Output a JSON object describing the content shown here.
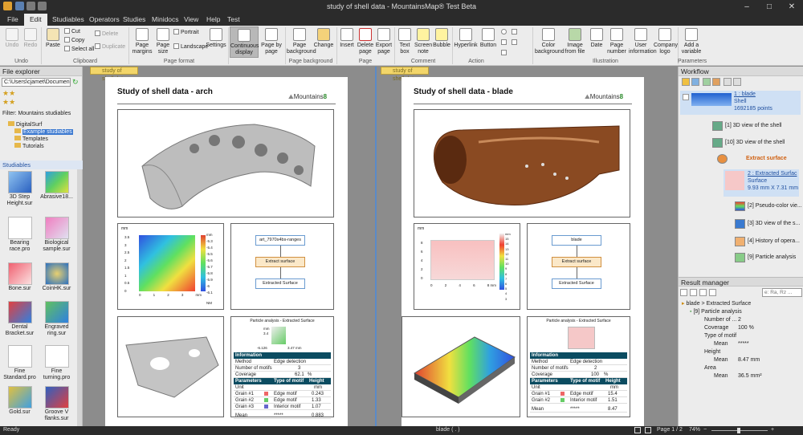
{
  "window": {
    "title": "study of shell data - MountainsMap® Test Beta",
    "minimize": "–",
    "maximize": "□",
    "close": "✕"
  },
  "menu": [
    "File",
    "Edit",
    "Studiables",
    "Operators",
    "Studies",
    "Minidocs",
    "View",
    "Help",
    "Test"
  ],
  "ribbon": {
    "undo": "Undo",
    "redo": "Redo",
    "undo_group": "Undo",
    "paste": "Paste",
    "cut": "Cut",
    "copy": "Copy",
    "select_all": "Select all",
    "delete": "Delete",
    "duplicate": "Duplicate",
    "clipboard_group": "Clipboard",
    "page_margins": "Page margins",
    "page_size": "Page size",
    "portrait": "Portrait",
    "landscape": "Landscape",
    "settings": "Settings",
    "page_format_group": "Page format",
    "continuous_display": "Continuous display",
    "page_by_page": "Page by page",
    "page_background": "Page background",
    "change": "Change",
    "page_background_group": "Page background",
    "insert": "Insert",
    "delete_page": "Delete page",
    "export_page": "Export page",
    "page_group": "Page",
    "text_box": "Text box",
    "screen_note": "Screen note",
    "bubble": "Bubble",
    "comment_group": "Comment",
    "hyperlink": "Hyperlink",
    "button": "Button",
    "action_group": "Action",
    "color_background": "Color background",
    "image_from_file": "Image from file",
    "date": "Date",
    "page_number": "Page number",
    "user_information": "User information",
    "company_logo": "Company logo",
    "illustration_group": "Illustration",
    "add_variable": "Add a variable",
    "parameters_group": "Parameters"
  },
  "file_explorer": {
    "title": "File explorer",
    "path": "C:\\Users\\cjamet\\Document",
    "filter": "Filter: Mountains studiables",
    "tree": [
      "DigitalSurf",
      "Example studiables",
      "Templates",
      "Tutorials"
    ],
    "studiables_title": "Studiables",
    "items": [
      {
        "name": "3D Step Height.sur"
      },
      {
        "name": "Abrasive18..."
      },
      {
        "name": "Bearing race.pro"
      },
      {
        "name": "Biological sample.sur"
      },
      {
        "name": "Bone.sur"
      },
      {
        "name": "CoinHK.sur"
      },
      {
        "name": "Dental Bracket.sur"
      },
      {
        "name": "Engraved ring.sur"
      },
      {
        "name": "Fine Standard.pro"
      },
      {
        "name": "Fine turning.pro"
      },
      {
        "name": "Gold.sur"
      },
      {
        "name": "Groove V flanks.sur"
      }
    ]
  },
  "docs": {
    "tab_left": "study of shell data",
    "tab_right": "study of shell data",
    "left": {
      "title": "Study of shell data - arch",
      "logo_text": "Mountains",
      "logo_num": "8",
      "map_unit": "mm",
      "map_xunit": "mm",
      "map_yticks": [
        "3.5",
        "3",
        "2.5",
        "2",
        "1.5",
        "1",
        "0.5",
        "0"
      ],
      "map_xticks": [
        "0",
        "1",
        "2",
        "3"
      ],
      "scale_ticks": [
        "mm",
        "-5.3",
        "-5.4",
        "-5.5",
        "-5.6",
        "-5.7",
        "-5.8",
        "-5.9",
        "-6",
        "-6.1"
      ],
      "scale_bottom": "NM",
      "wf_nodes": [
        "art_7970s4bs-ranges",
        "Extract surface",
        "Extracted Surface"
      ],
      "particle_title": "Particle analysis - Extracted Surface",
      "particle_scale": [
        "mm",
        "3.4",
        "-6.126",
        "3.47 mm"
      ],
      "info_header": "Information",
      "method_label": "Method",
      "method_value": "Edge detection",
      "motifs_label": "Number of motifs",
      "motifs_value": "3",
      "coverage_label": "Coverage",
      "coverage_value": "62.1",
      "coverage_unit": "%",
      "param_header": "Parameters",
      "type_header": "Type of motif",
      "height_header": "Height",
      "unit_label": "Unit",
      "unit_value": "mm",
      "grains": [
        {
          "name": "Grain #1",
          "type": "Edge motif",
          "height": "0.243"
        },
        {
          "name": "Grain #2",
          "type": "Edge motif",
          "height": "1.33"
        },
        {
          "name": "Grain #3",
          "type": "Interior motif",
          "height": "1.07"
        }
      ],
      "mean_label": "Mean",
      "mean_type": "*****",
      "mean_value": "0.883"
    },
    "right": {
      "title": "Study of shell data - blade",
      "logo_text": "Mountains",
      "logo_num": "8",
      "map_unit": "mm",
      "map_xunit": "mm",
      "map_yticks": [
        "8",
        "6",
        "4",
        "2",
        "0"
      ],
      "map_xticks": [
        "0",
        "2",
        "4",
        "6",
        "8 mm"
      ],
      "scale_ticks": [
        "mm",
        "15",
        "14",
        "13",
        "12",
        "11",
        "10",
        "9",
        "8",
        "7",
        "6",
        "5",
        "4",
        "3"
      ],
      "wf_nodes": [
        "blade",
        "Extract surface",
        "Extracted Surface"
      ],
      "particle_title": "Particle analysis - Extracted Surface",
      "info_header": "Information",
      "method_label": "Method",
      "method_value": "Edge detection",
      "motifs_label": "Number of motifs",
      "motifs_value": "2",
      "coverage_label": "Coverage",
      "coverage_value": "100",
      "coverage_unit": "%",
      "param_header": "Parameters",
      "type_header": "Type of motif",
      "height_header": "Height",
      "unit_label": "Unit",
      "unit_value": "mm",
      "grains": [
        {
          "name": "Grain #1",
          "type": "Edge motif",
          "height": "15.4"
        },
        {
          "name": "Grain #2",
          "type": "Interior motif",
          "height": "1.51"
        }
      ],
      "mean_label": "Mean",
      "mean_type": "*****",
      "mean_value": "8.47"
    }
  },
  "workflow": {
    "title": "Workflow",
    "root_title": "1 : blade",
    "root_sub": "Shell",
    "root_points": "1692185 points",
    "items": [
      "[1] 3D view of the shell",
      "[10] 3D view of the shell",
      "Extract surface",
      "2 : Extracted Surfac",
      "[2] Pseudo-color vie...",
      "[3] 3D view of the s...",
      "[4] History of opera...",
      "[9] Particle analysis"
    ],
    "extracted_sub": "Surface",
    "extracted_dims": "9.93 mm X 7.31 mm"
  },
  "result_manager": {
    "title": "Result manager",
    "search_placeholder": "e: Ra, Rz ...",
    "path": "blade > Extracted Surface",
    "study": "[9] Particle analysis",
    "rows": [
      {
        "label": "Number of ...",
        "value": "2"
      },
      {
        "label": "Coverage",
        "value": "100 %"
      },
      {
        "label": "Type of motif",
        "value": ""
      },
      {
        "label": "Mean",
        "value": "*****"
      },
      {
        "label": "Height",
        "value": ""
      },
      {
        "label": "Mean",
        "value": "8.47 mm"
      },
      {
        "label": "Area",
        "value": ""
      },
      {
        "label": "Mean",
        "value": "36.5 mm²"
      }
    ]
  },
  "status": {
    "left": "Ready",
    "center": "blade ( . )",
    "page": "Page 1 / 2",
    "zoom": "74%"
  },
  "colors": {
    "titlebar": "#2b2b2b",
    "ribbon": "#ececec",
    "accent": "#0b4c61",
    "tab": "#f3d66a"
  }
}
